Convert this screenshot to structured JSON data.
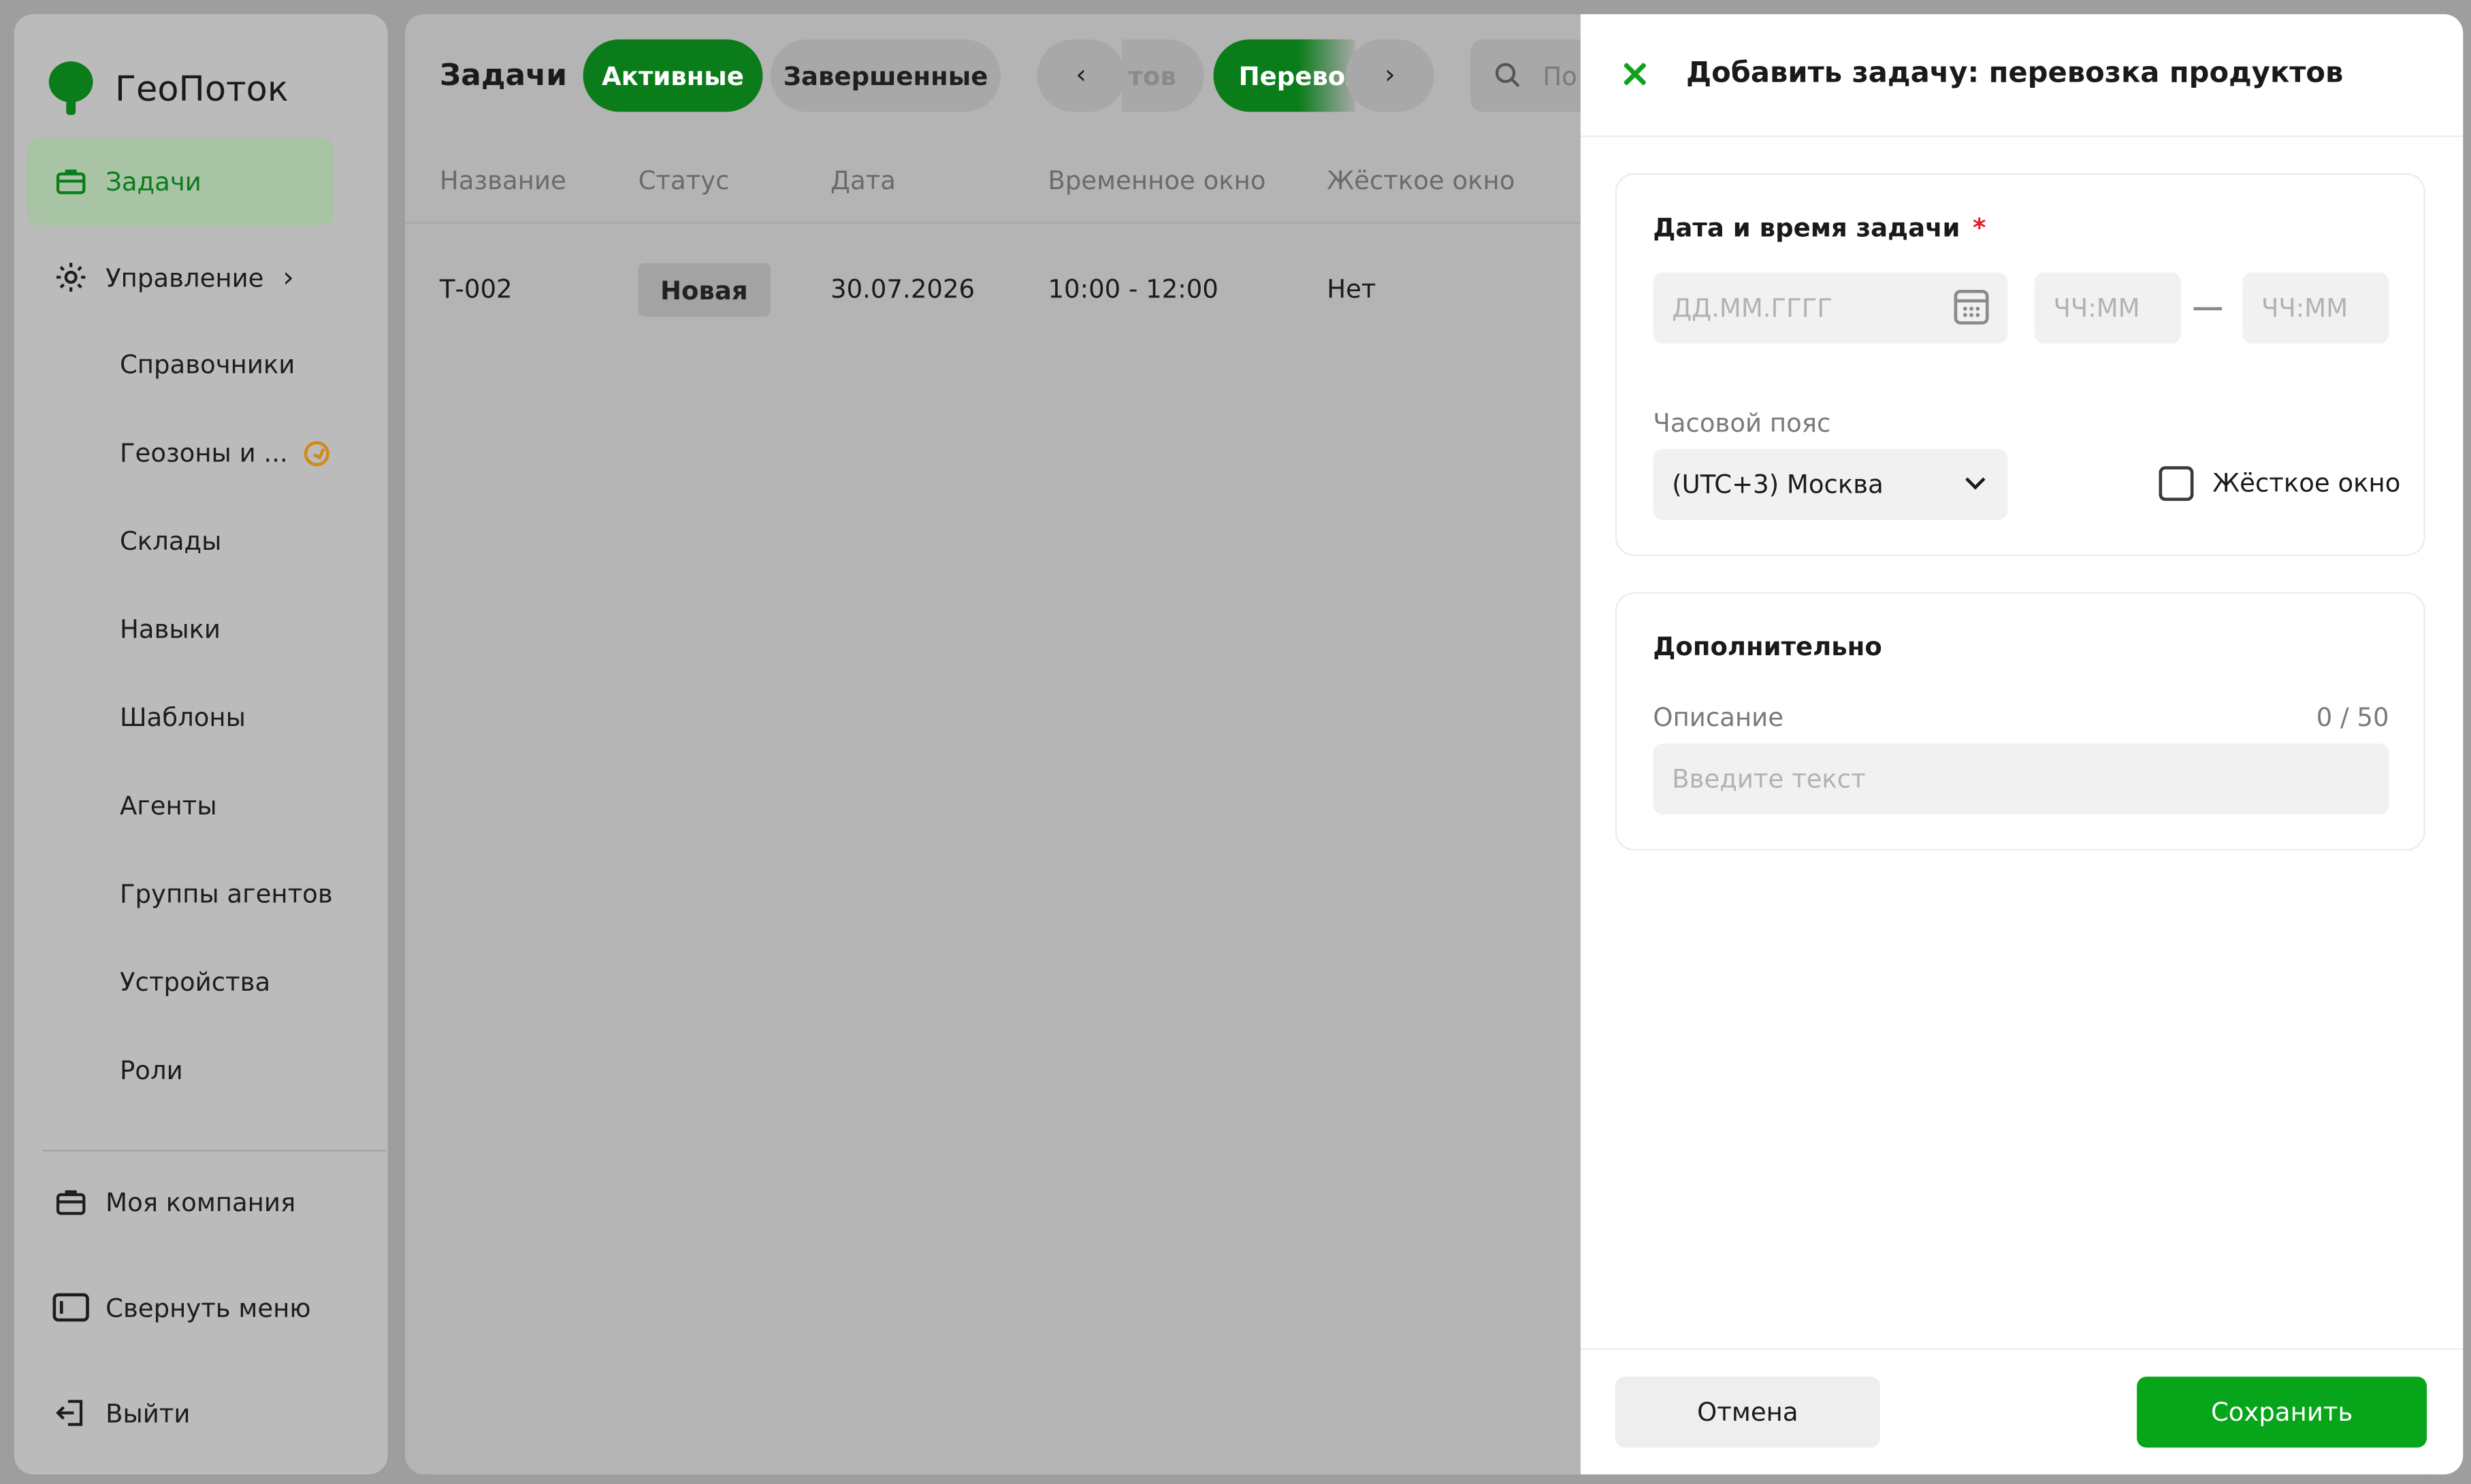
{
  "app": {
    "name": "ГеоПоток"
  },
  "sidebar": {
    "tasks": "Задачи",
    "management": "Управление",
    "sub_items": [
      "Справочники",
      "Геозоны и ...",
      "Склады",
      "Навыки",
      "Шаблоны",
      "Агенты",
      "Группы агентов",
      "Устройства",
      "Роли"
    ],
    "my_company": "Моя компания",
    "collapse": "Свернуть меню",
    "logout": "Выйти"
  },
  "main": {
    "title": "Задачи",
    "tabs": {
      "active": "Активные",
      "completed": "Завершенные"
    },
    "filter_prev_fragment": "тов",
    "filter_current_fragment": "Перевоз",
    "prev_arrow": "‹",
    "next_arrow": "›",
    "search_fragment": "По",
    "columns": [
      "Название",
      "Статус",
      "Дата",
      "Временное окно",
      "Жёсткое окно"
    ],
    "rows": [
      {
        "name": "Т-002",
        "status": "Новая",
        "date": "30.07.2026",
        "window": "10:00 - 12:00",
        "hard": "Нет"
      }
    ]
  },
  "modal": {
    "title": "Добавить задачу: перевозка продуктов",
    "datetime_section": "Дата и время задачи",
    "required_mark": "*",
    "date_placeholder": "ДД.ММ.ГГГГ",
    "time_from_placeholder": "ЧЧ:ММ",
    "time_to_placeholder": "ЧЧ:ММ",
    "timezone_label": "Часовой пояс",
    "timezone_value": "(UTC+3) Москва",
    "hard_window_label": "Жёсткое окно",
    "hard_window_checked": false,
    "extra_section": "Дополнительно",
    "description_label": "Описание",
    "description_counter": "0 / 50",
    "description_placeholder": "Введите текст",
    "cancel": "Отмена",
    "save": "Сохранить"
  },
  "colors": {
    "brand_green": "#0a7d1a",
    "save_green": "#07a51a",
    "required_red": "#e02020",
    "warning_orange": "#d08a18"
  },
  "icons": [
    "logo-tree-icon",
    "briefcase-icon",
    "gear-icon",
    "chevron-right-icon",
    "clock-icon",
    "panel-icon",
    "logout-icon",
    "search-icon",
    "close-icon",
    "calendar-icon",
    "chevron-down-icon"
  ]
}
